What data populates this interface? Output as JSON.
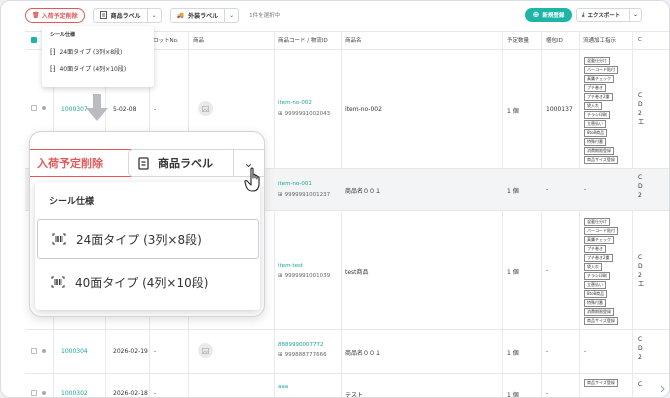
{
  "toolbar": {
    "delete_label": "入荷予定削除",
    "product_label": "商品ラベル",
    "outer_label": "外装ラベル",
    "selection_count": "1件を選択中",
    "new_button": "新規登録",
    "export_button": "エクスポート"
  },
  "table": {
    "headers": [
      "ロットNo.",
      "商品",
      "商品コード / 物流ID",
      "商品名",
      "予定数量",
      "梱包ID",
      "流通加工指示",
      "C"
    ],
    "rows": [
      {
        "id": "1000307",
        "date": "5-02-08",
        "lot": "-",
        "code": "item-no-002",
        "barcode": "9999991002043",
        "name": "item-no-002",
        "qty": "1 個",
        "pack": "1000137",
        "tags": [
          "混載仕分け",
          "バーコード貼付",
          "真贋チェック",
          "プチ巻き",
          "プチ巻き2重",
          "袋入れ",
          "チラシ印刷",
          "立替払い",
          "8to8商品",
          "特殊付番",
          "消費期限登録",
          "商品サイズ登録"
        ]
      },
      {
        "id": "",
        "date": "",
        "lot": "",
        "code": "item-no-001",
        "barcode": "9999991001237",
        "name": "商品名００１",
        "qty": "1 個",
        "pack": "-",
        "tags": []
      },
      {
        "id": "",
        "date": "",
        "lot": "",
        "code": "item-test",
        "barcode": "9999991001039",
        "name": "test商品",
        "qty": "1 個",
        "pack": "-",
        "tags": [
          "混載仕分け",
          "バーコード貼付",
          "真贋チェック",
          "プチ巻き",
          "プチ巻き2重",
          "袋入れ",
          "チラシ印刷",
          "立替払い",
          "8to8商品",
          "特殊付番",
          "消費期限登録",
          "商品サイズ登録"
        ]
      },
      {
        "id": "1000304",
        "date": "2026-02-19",
        "lot": "-",
        "code": "8889990007772",
        "barcode": "999888777666",
        "name": "商品名００１",
        "qty": "1 個",
        "pack": "-",
        "tags": []
      },
      {
        "id": "1000302",
        "date": "2026-02-18",
        "lot": "-",
        "code": "aaa",
        "barcode": "",
        "name": "テスト",
        "qty": "1 個",
        "pack": "-",
        "tags": [
          "商品サイズ登録"
        ]
      }
    ],
    "last_col": [
      "C",
      "D",
      "2",
      "工"
    ]
  },
  "mini_dropdown": {
    "title": "シール仕様",
    "options": [
      "24面タイプ (3列×8段)",
      "40面タイプ (4列×10段)"
    ]
  },
  "zoom": {
    "delete_label": "入荷予定削除",
    "product_label": "商品ラベル",
    "dropdown_title": "シール仕様",
    "options": [
      "24面タイプ (3列×8段)",
      "40面タイプ (4列×10段)"
    ]
  },
  "colors": {
    "accent": "#1fb5a6",
    "danger": "#e05a5a"
  }
}
